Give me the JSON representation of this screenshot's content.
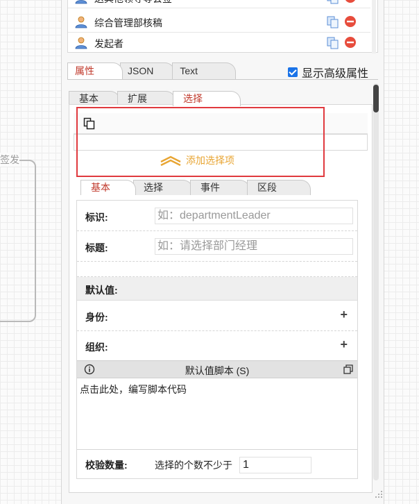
{
  "canvas": {
    "node_label": "签发"
  },
  "users": [
    {
      "name": "送其他领导等会签",
      "icon": "user-icon"
    },
    {
      "name": "综合管理部核稿",
      "icon": "user-icon"
    },
    {
      "name": "发起者",
      "icon": "user-icon"
    }
  ],
  "main_tabs": [
    {
      "label": "属性",
      "active": true
    },
    {
      "label": "JSON",
      "active": false
    },
    {
      "label": "Text",
      "active": false
    }
  ],
  "show_advanced_label": "显示高级属性",
  "show_advanced_checked": true,
  "sub_tabs": [
    {
      "label": "基本",
      "active": false
    },
    {
      "label": "扩展",
      "active": false
    },
    {
      "label": "选择",
      "active": true
    }
  ],
  "select_panel": {
    "add_option_label": "添加选择项"
  },
  "field_tabs": [
    {
      "label": "基本",
      "active": true
    },
    {
      "label": "选择",
      "active": false
    },
    {
      "label": "事件",
      "active": false
    },
    {
      "label": "区段",
      "active": false
    }
  ],
  "fields": {
    "id_label": "标识:",
    "id_placeholder": "如：departmentLeader",
    "title_label": "标题:",
    "title_placeholder": "如：请选择部门经理",
    "default_section": "默认值:",
    "identity_label": "身份:",
    "org_label": "组织:",
    "plus_symbol": "+",
    "script_title": "默认值脚本 (S)",
    "script_placeholder": "点击此处，编写脚本代码",
    "validate_label": "校验数量:",
    "validate_text": "选择的个数不少于",
    "validate_value": "1"
  },
  "colors": {
    "active_tab_text": "#c0392b",
    "highlight_box": "#e0393e",
    "add_option": "#e8a533",
    "checkbox": "#1a73e8"
  }
}
